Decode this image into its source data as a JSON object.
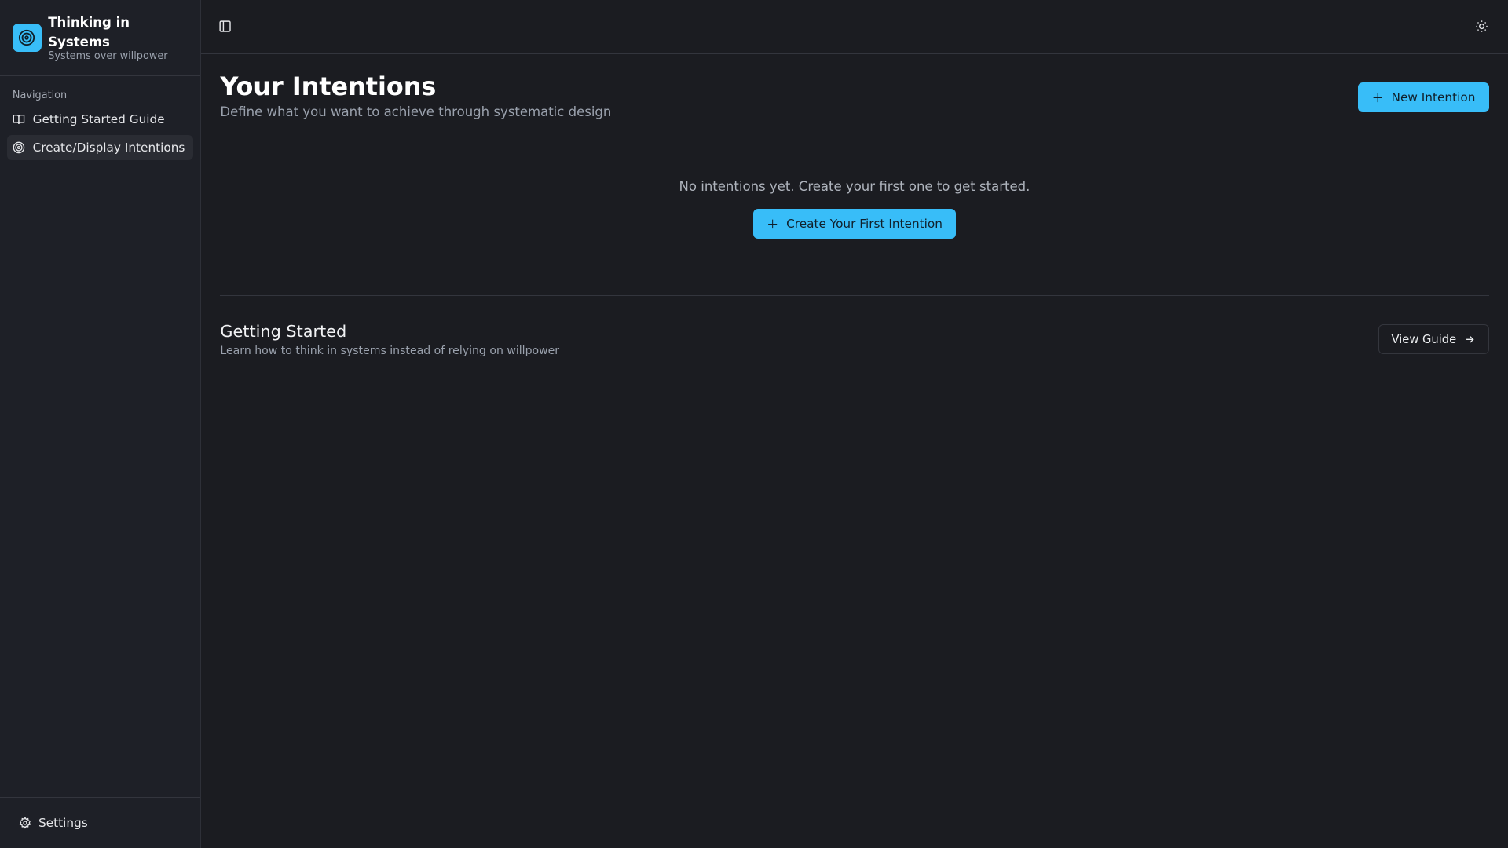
{
  "brand": {
    "title": "Thinking in Systems",
    "subtitle": "Systems over willpower"
  },
  "sidebar": {
    "section_label": "Navigation",
    "items": [
      {
        "label": "Getting Started Guide",
        "icon": "book-open-icon"
      },
      {
        "label": "Create/Display Intentions",
        "icon": "target-icon",
        "active": true
      }
    ],
    "settings_label": "Settings"
  },
  "page": {
    "title": "Your Intentions",
    "subtitle": "Define what you want to achieve through systematic design",
    "new_button": "New Intention"
  },
  "empty_state": {
    "message": "No intentions yet. Create your first one to get started.",
    "button": "Create Your First Intention"
  },
  "getting_started": {
    "title": "Getting Started",
    "description": "Learn how to think in systems instead of relying on willpower",
    "button": "View Guide"
  },
  "colors": {
    "accent": "#38bdf8",
    "background": "#1b1c21",
    "sidebar": "#1e2027"
  }
}
